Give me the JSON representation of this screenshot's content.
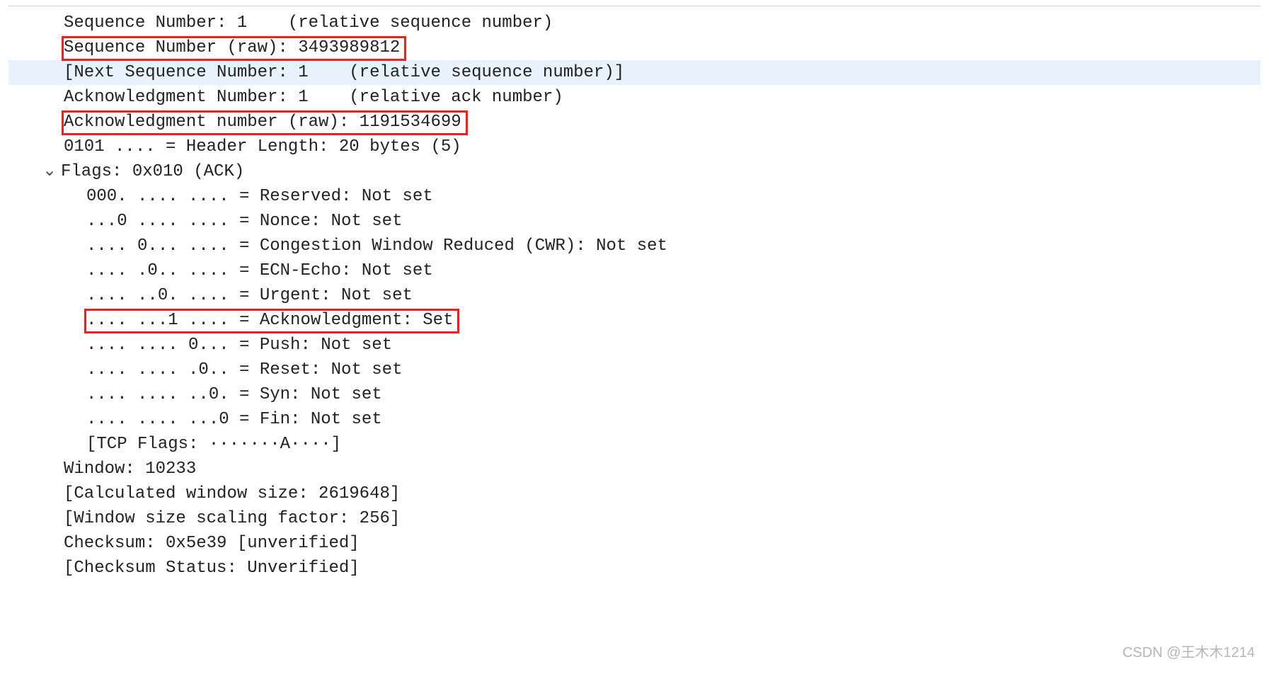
{
  "lines": {
    "seq_rel": "Sequence Number: 1    (relative sequence number)",
    "seq_raw": "Sequence Number (raw): 3493989812",
    "next_seq": "[Next Sequence Number: 1    (relative sequence number)]",
    "ack_rel": "Acknowledgment Number: 1    (relative ack number)",
    "ack_raw": "Acknowledgment number (raw): 1191534699",
    "hdr_len": "0101 .... = Header Length: 20 bytes (5)",
    "flags_hdr": "Flags: 0x010 (ACK)",
    "reserved": "000. .... .... = Reserved: Not set",
    "nonce": "...0 .... .... = Nonce: Not set",
    "cwr": ".... 0... .... = Congestion Window Reduced (CWR): Not set",
    "ecn": ".... .0.. .... = ECN-Echo: Not set",
    "urgent": ".... ..0. .... = Urgent: Not set",
    "ack_flag": ".... ...1 .... = Acknowledgment: Set",
    "push": ".... .... 0... = Push: Not set",
    "reset": ".... .... .0.. = Reset: Not set",
    "syn": ".... .... ..0. = Syn: Not set",
    "fin": ".... .... ...0 = Fin: Not set",
    "tcp_flags": "[TCP Flags: ·······A····]",
    "window": "Window: 10233",
    "calc_win": "[Calculated window size: 2619648]",
    "scale": "[Window size scaling factor: 256]",
    "checksum": "Checksum: 0x5e39 [unverified]",
    "chk_status": "[Checksum Status: Unverified]"
  },
  "toggle": "⌄",
  "watermark": "CSDN @王木木1214"
}
